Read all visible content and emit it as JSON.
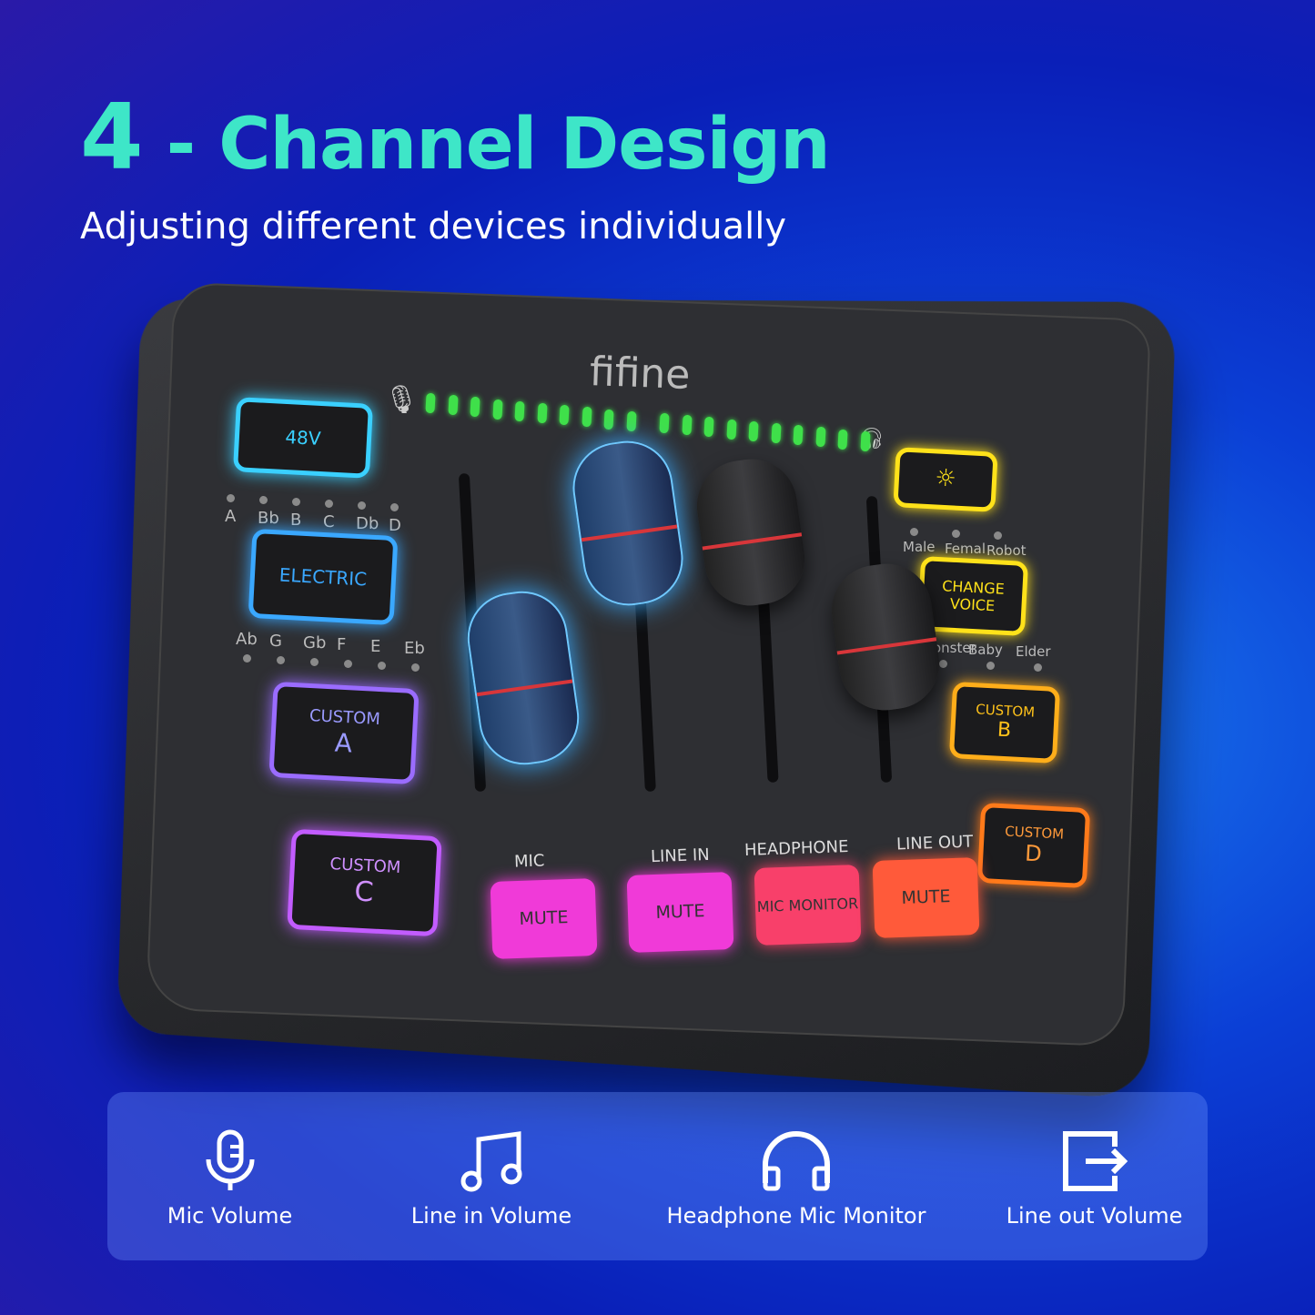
{
  "header": {
    "number": "4",
    "title": " - Channel Design",
    "subtitle": "Adjusting different devices individually"
  },
  "device": {
    "brand": "fifine",
    "buttons": {
      "phantom": "48V",
      "electric": "ELECTRIC",
      "custom_a_label": "CUSTOM",
      "custom_a": "A",
      "custom_c_label": "CUSTOM",
      "custom_c": "C",
      "custom_b_label": "CUSTOM",
      "custom_b": "B",
      "custom_d_label": "CUSTOM",
      "custom_d": "D",
      "change_voice": "CHANGE VOICE",
      "light_icon": "sun-icon"
    },
    "keys_top": [
      "A",
      "Bb",
      "B",
      "C",
      "Db",
      "D"
    ],
    "keys_bottom": [
      "Ab",
      "G",
      "Gb",
      "F",
      "E",
      "Eb"
    ],
    "voices_top": [
      "Male",
      "Femal",
      "Robot"
    ],
    "voices_bottom": [
      "Monster",
      "Baby",
      "Elder"
    ],
    "channels": [
      {
        "label": "MIC",
        "button": "MUTE",
        "color": "#f03ad8"
      },
      {
        "label": "LINE IN",
        "button": "MUTE",
        "color": "#f03ad8"
      },
      {
        "label": "HEADPHONE",
        "button": "MIC MONITOR",
        "color": "#f8406a"
      },
      {
        "label": "LINE OUT",
        "button": "MUTE",
        "color": "#ff5a3a"
      }
    ],
    "colors": {
      "cyan": "#3ad0ff",
      "blue": "#3aa8ff",
      "purple": "#9a6cff",
      "violet": "#c25cff",
      "yellow": "#ffe21a",
      "orange": "#ffae1a",
      "deeporange": "#ff7a1a",
      "meter": "#3fe04a"
    }
  },
  "features": [
    {
      "icon": "microphone-icon",
      "label": "Mic Volume"
    },
    {
      "icon": "music-note-icon",
      "label": "Line in Volume"
    },
    {
      "icon": "headphone-icon",
      "label": "Headphone Mic Monitor"
    },
    {
      "icon": "output-icon",
      "label": "Line out Volume"
    }
  ]
}
